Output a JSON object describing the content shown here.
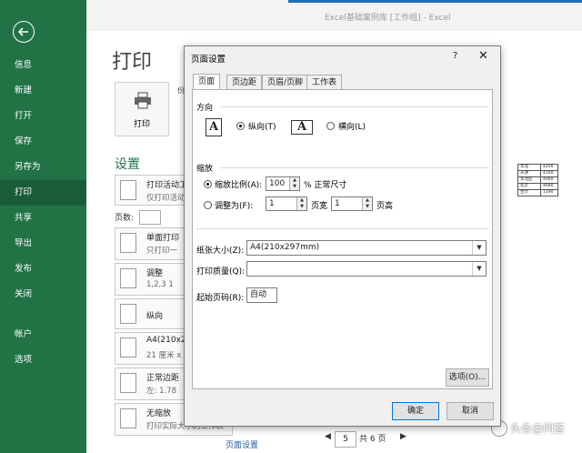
{
  "window": {
    "title": "Excel基础案例库 [工作组] - Excel"
  },
  "sidebar": {
    "items": [
      {
        "label": "信息"
      },
      {
        "label": "新建"
      },
      {
        "label": "打开"
      },
      {
        "label": "保存"
      },
      {
        "label": "另存为"
      },
      {
        "label": "打印"
      },
      {
        "label": "共享"
      },
      {
        "label": "导出"
      },
      {
        "label": "发布"
      },
      {
        "label": "关闭"
      },
      {
        "label": "帐户"
      },
      {
        "label": "选项"
      }
    ],
    "active": "打印"
  },
  "print": {
    "heading": "打印",
    "print_button": "打印",
    "copies_label": "份",
    "settings_heading": "设置",
    "pages_label": "页数:",
    "settings": [
      {
        "line1": "打印活动工",
        "line2": "仅打印活动"
      },
      {
        "line1": "单面打印",
        "line2": "只打印一"
      },
      {
        "line1": "调整",
        "line2": "1,2,3    1"
      },
      {
        "line1": "纵向",
        "line2": ""
      },
      {
        "line1": "A4(210x2",
        "line2": "21 厘米 x"
      },
      {
        "line1": "正常边距",
        "line2": "左: 1.78"
      },
      {
        "line1": "无缩放",
        "line2": "打印实际大小的工作表"
      }
    ],
    "page_setup_link": "页面设置"
  },
  "preview": {
    "current_page": "5",
    "total_pages": "共 6 页",
    "rows": [
      [
        "华北",
        "4200"
      ],
      [
        "天津",
        "4200"
      ],
      [
        "华北区",
        "4060"
      ],
      [
        "北京",
        "4680"
      ],
      [
        "合计",
        "1190"
      ]
    ]
  },
  "dialog": {
    "title": "页面设置",
    "help": "?",
    "close": "✕",
    "tabs": [
      "页面",
      "页边距",
      "页眉/页脚",
      "工作表"
    ],
    "orientation": {
      "heading": "方向",
      "portrait": "纵向(T)",
      "landscape": "横向(L)",
      "selected": "portrait"
    },
    "scaling": {
      "heading": "缩放",
      "adjust_label": "缩放比例(A):",
      "adjust_value": "100",
      "adjust_unit": "% 正常尺寸",
      "fit_label": "调整为(F):",
      "fit_wide_value": "1",
      "fit_wide_unit": "页宽",
      "fit_tall_value": "1",
      "fit_tall_unit": "页高",
      "selected": "adjust"
    },
    "paper_size": {
      "label": "纸张大小(Z):",
      "value": "A4(210x297mm)"
    },
    "print_quality": {
      "label": "打印质量(Q):",
      "value": ""
    },
    "first_page": {
      "label": "起始页码(R):",
      "value": "自动"
    },
    "options_button": "选项(O)...",
    "ok_button": "确定",
    "cancel_button": "取消"
  },
  "watermark": "头条@问答",
  "colors": {
    "sidebar": "#217346",
    "sidebar_active": "#1a5c38",
    "accent": "#0078d7"
  }
}
